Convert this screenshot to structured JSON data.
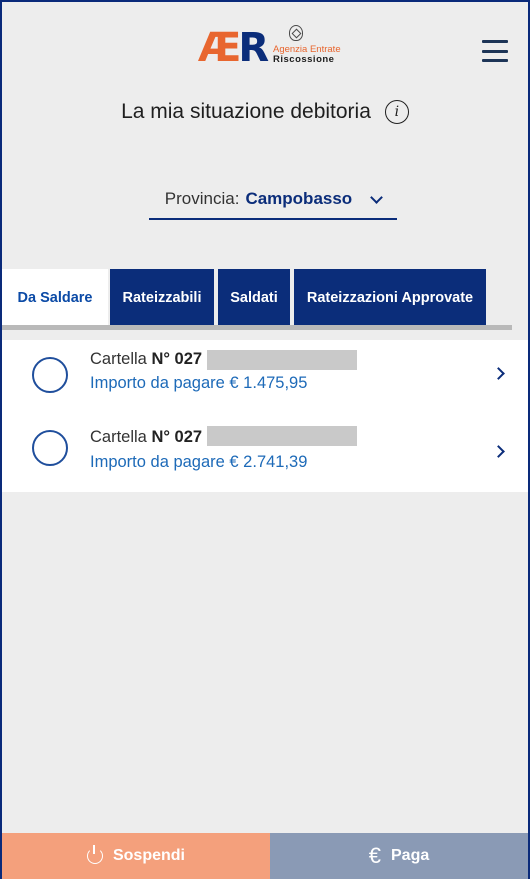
{
  "header": {
    "logo": {
      "mark": "AER",
      "line1": "Agenzia Entrate",
      "line2": "Riscossione"
    },
    "title": "La mia situazione debitoria"
  },
  "province": {
    "label": "Provincia:",
    "value": "Campobasso"
  },
  "tabs": [
    {
      "label": "Da Saldare",
      "active": true
    },
    {
      "label": "Rateizzabili",
      "active": false
    },
    {
      "label": "Saldati",
      "active": false
    },
    {
      "label": "Rateizzazioni Approvate",
      "active": false
    }
  ],
  "items": [
    {
      "label_prefix": "Cartella",
      "number": "N° 027",
      "amount": "Importo da pagare € 1.475,95"
    },
    {
      "label_prefix": "Cartella",
      "number": "N° 027",
      "amount": "Importo da pagare € 2.741,39"
    }
  ],
  "footer": {
    "sospendi": "Sospendi",
    "paga": "Paga"
  },
  "colors": {
    "primary": "#0b2d7a",
    "accent_orange": "#f4a07c",
    "muted_blue": "#8a9ab5",
    "link_blue": "#1d6ab8"
  },
  "icons": [
    "menu-icon",
    "info-icon",
    "chevron-down-icon",
    "radio-icon",
    "chevron-right-icon",
    "power-icon",
    "euro-icon"
  ]
}
